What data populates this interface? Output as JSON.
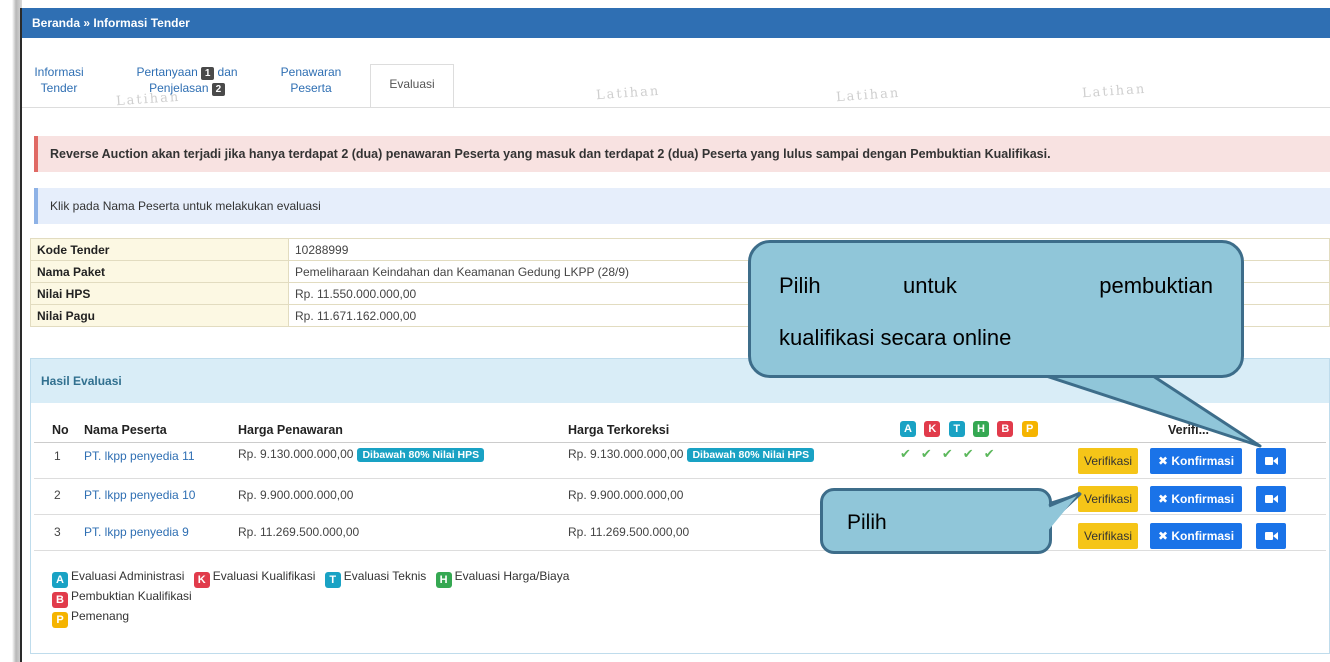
{
  "breadcrumb": "Beranda » Informasi Tender",
  "tabs": [
    {
      "line1": "Informasi",
      "line2": "Tender"
    },
    {
      "line1a": "Pertanyaan",
      "num1": "1",
      "line1b": "dan",
      "line2a": "Penjelasan",
      "num2": "2"
    },
    {
      "line1": "Penawaran",
      "line2": "Peserta"
    },
    {
      "label": "Evaluasi"
    }
  ],
  "watermark": "Latihan",
  "alert_red": "Reverse Auction akan terjadi jika hanya terdapat 2 (dua) penawaran Peserta yang masuk dan terdapat 2 (dua) Peserta yang lulus sampai dengan Pembuktian Kualifikasi.",
  "alert_blue": "Klik pada Nama Peserta untuk melakukan evaluasi",
  "info": [
    {
      "key": "Kode Tender",
      "value": "10288999"
    },
    {
      "key": "Nama Paket",
      "value": "Pemeliharaan Keindahan dan Keamanan Gedung LKPP (28/9)"
    },
    {
      "key": "Nilai HPS",
      "value": "Rp. 11.550.000.000,00"
    },
    {
      "key": "Nilai Pagu",
      "value": "Rp. 11.671.162.000,00"
    }
  ],
  "panel_title": "Hasil Evaluasi",
  "columns": {
    "no": "No",
    "nama": "Nama Peserta",
    "harga": "Harga Penawaran",
    "terkoreksi": "Harga Terkoreksi",
    "verifikasi": "Verifi..."
  },
  "status_letters": [
    "A",
    "K",
    "T",
    "H",
    "B",
    "P"
  ],
  "rows": [
    {
      "no": "1",
      "nama": "PT. lkpp penyedia 11",
      "harga": "Rp. 9.130.000.000,00",
      "badge": "Dibawah 80% Nilai HPS",
      "terkoreksi": "Rp. 9.130.000.000,00",
      "badge2": "Dibawah 80% Nilai HPS",
      "checks": [
        "✔",
        "✔",
        "✔",
        "✔",
        "✔"
      ]
    },
    {
      "no": "2",
      "nama": "PT. lkpp penyedia 10",
      "harga": "Rp. 9.900.000.000,00",
      "terkoreksi": "Rp. 9.900.000.000,00"
    },
    {
      "no": "3",
      "nama": "PT. lkpp penyedia 9",
      "harga": "Rp. 11.269.500.000,00",
      "terkoreksi": "Rp. 11.269.500.000,00"
    }
  ],
  "buttons": {
    "verifikasi": "Verifikasi",
    "konfirmasi": "✖ Konfirmasi"
  },
  "legend": [
    {
      "letter": "A",
      "label": "Evaluasi Administrasi"
    },
    {
      "letter": "K",
      "label": "Evaluasi Kualifikasi"
    },
    {
      "letter": "T",
      "label": "Evaluasi Teknis"
    },
    {
      "letter": "H",
      "label": "Evaluasi Harga/Biaya"
    },
    {
      "letter": "B",
      "label": "Pembuktian Kualifikasi"
    },
    {
      "letter": "P",
      "label": "Pemenang"
    }
  ],
  "callout_big": {
    "line1a": "Pilih",
    "line1b": "untuk",
    "line1c": "pembuktian",
    "line2": "kualifikasi secara online"
  },
  "callout_small": "Pilih",
  "colors": {
    "header": "#2f6fb3",
    "callout_fill": "#90c6d9",
    "callout_border": "#3d6d8a",
    "verifikasi": "#f5c518",
    "konfirmasi": "#1a73e8"
  }
}
